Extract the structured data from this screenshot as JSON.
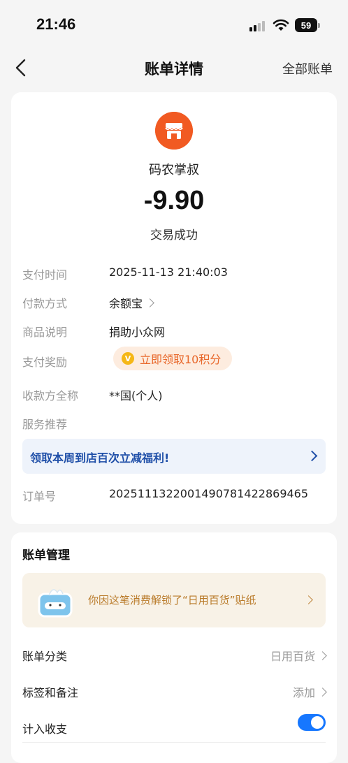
{
  "status_bar": {
    "time": "21:46",
    "battery": "59"
  },
  "nav": {
    "title": "账单详情",
    "right_link": "全部账单"
  },
  "merchant": {
    "name": "码农掌叔",
    "amount": "-9.90",
    "status": "交易成功"
  },
  "details": {
    "pay_time_label": "支付时间",
    "pay_time": "2025-11-13 21:40:03",
    "pay_method_label": "付款方式",
    "pay_method": "余额宝",
    "item_desc_label": "商品说明",
    "item_desc": "捐助小众网",
    "reward_label": "支付奖励",
    "reward_text": "立即领取10积分",
    "payee_label": "收款方全称",
    "payee": "**国(个人)",
    "service_label": "服务推荐",
    "promo_text": "领取本周到店百次立减福利!",
    "order_label": "订单号",
    "order_no": "2025111322001490781422869465"
  },
  "management": {
    "title": "账单管理",
    "sticker_text": "你因这笔消费解锁了“日用百货”贴纸",
    "category_label": "账单分类",
    "category_value": "日用百货",
    "tags_label": "标签和备注",
    "tags_value": "添加",
    "count_label": "计入收支",
    "count_enabled": true
  },
  "colors": {
    "merchant_icon": "#f15a22",
    "accent_blue": "#1677ff",
    "reward_orange": "#e8672a"
  }
}
